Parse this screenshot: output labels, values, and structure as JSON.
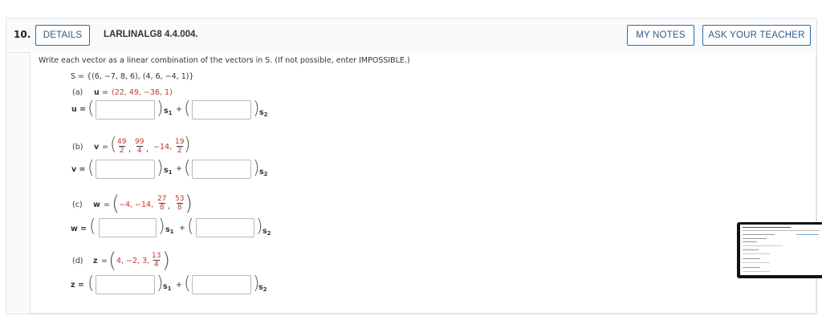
{
  "header": {
    "question_number": "10.",
    "details_button": "DETAILS",
    "problem_id": "LARLINALG8 4.4.004.",
    "my_notes_button": "MY NOTES",
    "ask_teacher_button": "ASK YOUR TEACHER"
  },
  "prompt": {
    "instruction": "Write each vector as a linear combination of the vectors in S. (If not possible, enter IMPOSSIBLE.)",
    "set_label": "S = {(6, −7, 8, 6), (4, 6, −4, 1)}"
  },
  "parts": {
    "a": {
      "label": "(a)",
      "vector_name": "u",
      "eq_sign": "=",
      "vector_value": "(22, 49, −36, 1)",
      "answer_label": "u ="
    },
    "b": {
      "label": "(b)",
      "vector_name": "v",
      "eq_sign": "=",
      "f1_num": "49",
      "f1_den": "2",
      "f2_num": "99",
      "f2_den": "4",
      "mid": "−14,",
      "f3_num": "19",
      "f3_den": "2",
      "answer_label": "v ="
    },
    "c": {
      "label": "(c)",
      "vector_name": "w",
      "eq_sign": "=",
      "prefix": "−4, −14,",
      "f1_num": "27",
      "f1_den": "8",
      "f2_num": "53",
      "f2_den": "8",
      "answer_label": "w ="
    },
    "d": {
      "label": "(d)",
      "vector_name": "z",
      "eq_sign": "=",
      "prefix": "4, −2, 3,",
      "f1_num": "13",
      "f1_den": "4",
      "answer_label": "z ="
    }
  },
  "basis": {
    "s1": "s",
    "s1_sub": "1",
    "s2": "s",
    "s2_sub": "2",
    "plus": "+"
  },
  "answers": {
    "a1": "",
    "a2": "",
    "b1": "",
    "b2": "",
    "c1": "",
    "c2": "",
    "d1": "",
    "d2": ""
  },
  "colors": {
    "button_border": "#2b6cb0",
    "button_text": "#2a5a8a",
    "value_red": "#c0392b"
  }
}
